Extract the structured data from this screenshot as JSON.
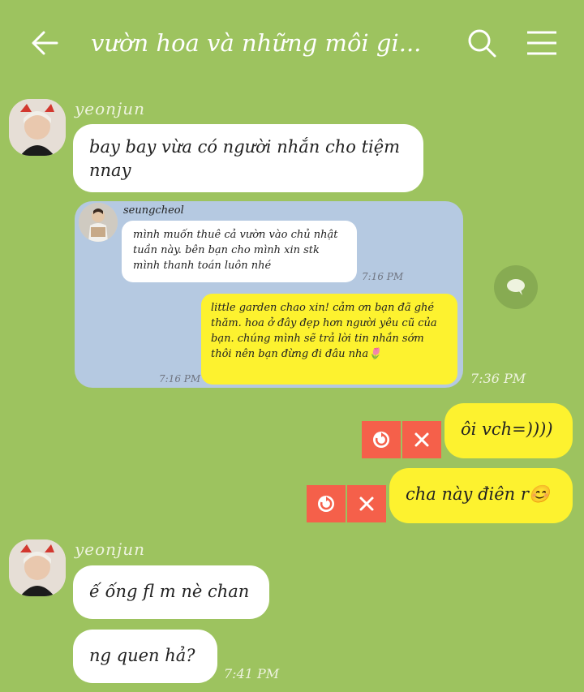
{
  "header": {
    "title": "vườn hoa và những môi gi...",
    "icons": [
      "back-arrow-icon",
      "search-icon",
      "hamburger-menu-icon"
    ]
  },
  "messages": [
    {
      "sender": "yeonjun",
      "bubbles": [
        "bay bay vừa có người nhắn cho tiệm nnay"
      ]
    },
    {
      "type": "image",
      "time": "7:36 PM",
      "screenshot": {
        "sender": "seungcheol",
        "incoming": "mình muốn thuê cả vườn vào chủ nhật tuần này. bên bạn cho mình xin stk mình thanh toán luôn nhé",
        "incoming_time": "7:16 PM",
        "reply": "little garden chao xin! cảm ơn bạn đã ghé thăm. hoa ở đây đẹp hơn người yêu cũ của bạn. chúng mình sẽ trả lời tin nhắn sớm thôi nên bạn đừng đi đâu nha🌷",
        "reply_time": "7:16 PM"
      }
    },
    {
      "outgoing": true,
      "text": "ôi vch=))))",
      "status": "failed"
    },
    {
      "outgoing": true,
      "text": "cha này điên r😊",
      "status": "failed"
    },
    {
      "sender": "yeonjun",
      "bubbles": [
        "ế ống fl m nè chan",
        "ng quen hả?"
      ],
      "time": "7:41 PM"
    }
  ],
  "colors": {
    "chat_background": "#9dc35f",
    "outgoing_bubble": "#fdf22f",
    "incoming_bubble": "#ffffff",
    "failed_action": "#f5604a",
    "screenshot_background": "#b5c9e1"
  }
}
